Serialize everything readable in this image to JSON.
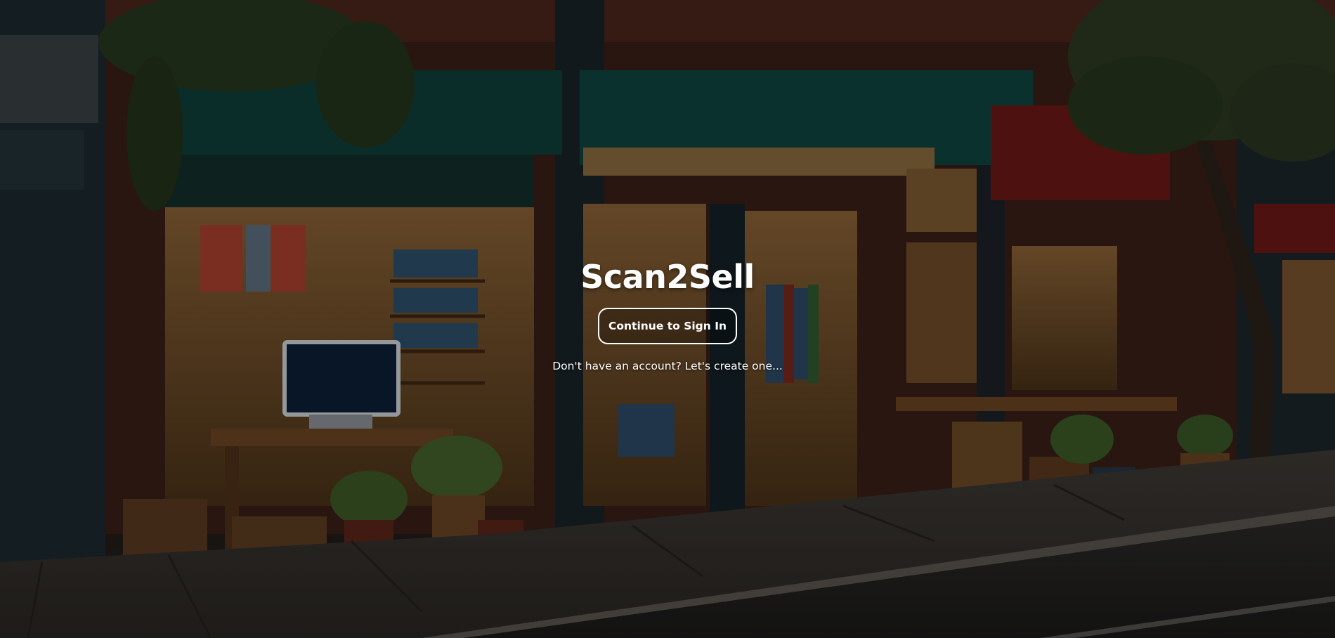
{
  "app": {
    "title": "Scan2Sell"
  },
  "auth": {
    "signin_label": "Continue to Sign In",
    "create_account_text": "Don't have an account? Let's create one..."
  },
  "background": {
    "description_icon": "storefront-street-illustration",
    "palette": {
      "awning_green": "#0f4a45",
      "awning_red": "#7a1a1a",
      "brick": "#5a2a22",
      "shop_light": "#c89a5a",
      "sidewalk": "#4a4640"
    }
  }
}
